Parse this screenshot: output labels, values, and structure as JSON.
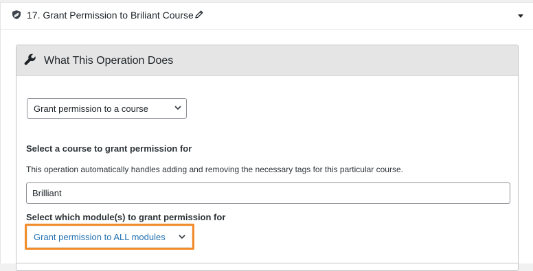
{
  "operation": {
    "title": "17. Grant Permission to Briliant Course",
    "shield_icon": "shield-icon",
    "edit_icon": "pencil-icon",
    "toggle_icon": "caret-down-icon"
  },
  "box": {
    "title": "What This Operation Does",
    "header_icon": "wrench-icon"
  },
  "operation_select": {
    "value": "Grant permission to a course"
  },
  "course": {
    "label": "Select a course to grant permission for",
    "description": "This operation automatically handles adding and removing the necessary tags for this particular course.",
    "value": "Brilliant"
  },
  "module": {
    "label": "Select which module(s) to grant permission for",
    "value": "Grant permission to ALL modules"
  },
  "colors": {
    "highlight": "#f28b28",
    "link": "#2271b1",
    "header_bg": "#e5e5e5"
  }
}
